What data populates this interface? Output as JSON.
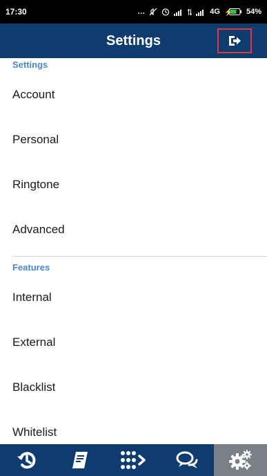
{
  "status_bar": {
    "time": "17:30",
    "network": "4G",
    "battery_percent": "54%"
  },
  "app_bar": {
    "title": "Settings",
    "logout_icon": "logout-icon"
  },
  "sections": [
    {
      "header": "Settings",
      "items": [
        "Account",
        "Personal",
        "Ringtone",
        "Advanced"
      ]
    },
    {
      "header": "Features",
      "items": [
        "Internal",
        "External",
        "Blacklist",
        "Whitelist"
      ]
    }
  ],
  "bottom_nav": {
    "items": [
      {
        "icon": "recent-calls-icon",
        "active": false
      },
      {
        "icon": "contacts-book-icon",
        "active": false
      },
      {
        "icon": "dialpad-icon",
        "active": false
      },
      {
        "icon": "messages-icon",
        "active": false
      },
      {
        "icon": "settings-gears-icon",
        "active": true
      }
    ],
    "active_index": 4
  },
  "colors": {
    "primary": "#0e3c6e",
    "accent_text": "#4a86c8",
    "highlight_border": "#e0393e",
    "active_nav": "#7a7f88"
  }
}
